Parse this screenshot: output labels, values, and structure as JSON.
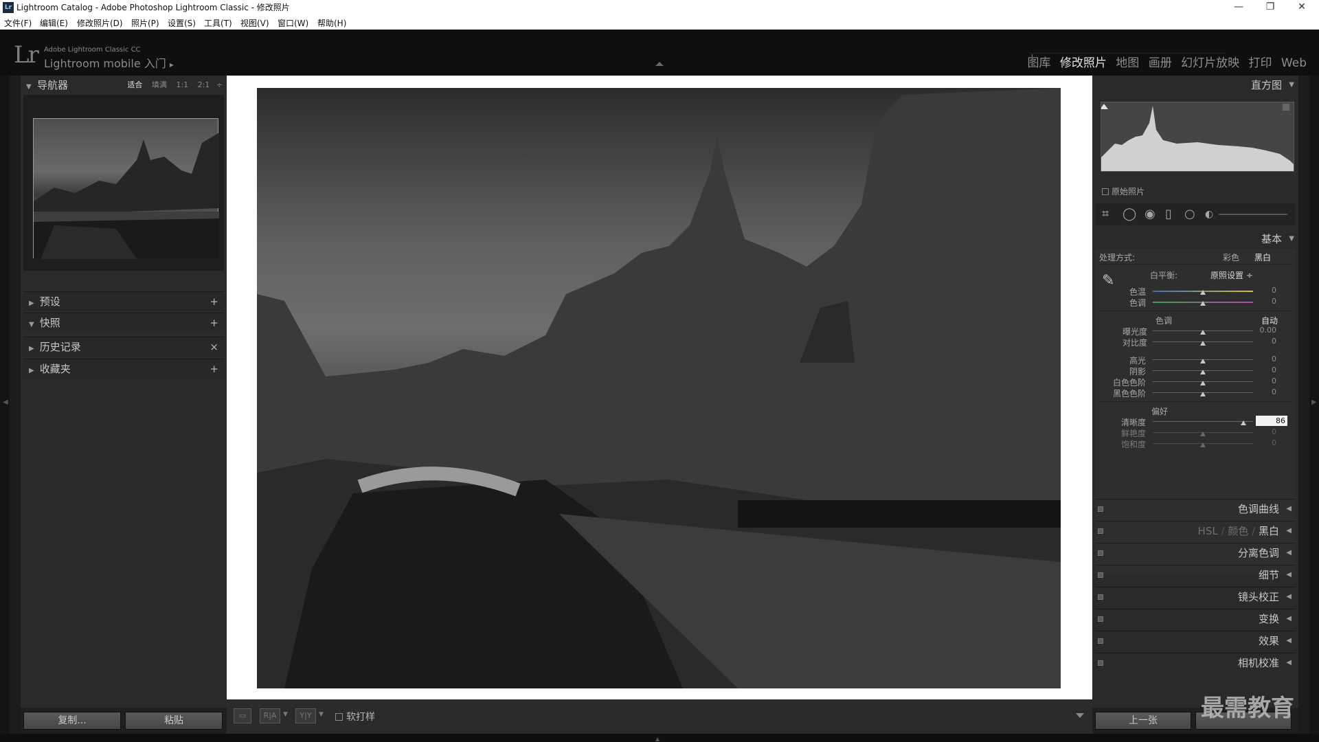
{
  "window": {
    "title": "Lightroom Catalog - Adobe Photoshop Lightroom Classic - 修改照片",
    "app_icon": "Lr",
    "minimize": "—",
    "restore": "❐",
    "close": "✕"
  },
  "menu": [
    "文件(F)",
    "编辑(E)",
    "修改照片(D)",
    "照片(P)",
    "设置(S)",
    "工具(T)",
    "视图(V)",
    "窗口(W)",
    "帮助(H)"
  ],
  "identity": {
    "logo": "Lr",
    "subtitle": "Adobe Lightroom Classic CC",
    "mobile": "Lightroom mobile 入门",
    "play": "▸"
  },
  "modules": {
    "library": "图库",
    "develop": "修改照片",
    "map": "地图",
    "book": "画册",
    "slideshow": "幻灯片放映",
    "print": "打印",
    "web": "Web"
  },
  "left": {
    "navigator": {
      "title": "导航器",
      "fit": "适合",
      "fill": "填满",
      "one": "1:1",
      "two": "2:1"
    },
    "presets": {
      "title": "预设",
      "action": "+"
    },
    "snapshots": {
      "title": "快照",
      "action": "+"
    },
    "history": {
      "title": "历史记录",
      "action": "×"
    },
    "collections": {
      "title": "收藏夹",
      "action": "+"
    },
    "copy_label": "复制...",
    "paste_label": "粘贴"
  },
  "toolbar": {
    "soft_proof": "软打样",
    "ra": "R|A",
    "yy": "Y|Y"
  },
  "right": {
    "histogram": {
      "title": "直方图",
      "original": "原始照片"
    },
    "basic": {
      "title": "基本",
      "treatment": "处理方式:",
      "color": "彩色",
      "bw": "黑白",
      "wb": "白平衡:",
      "wb_value": "原照设置 ÷",
      "temp": {
        "label": "色温",
        "value": "0"
      },
      "tint": {
        "label": "色调",
        "value": "0"
      },
      "tone_title": "色调",
      "auto": "自动",
      "exposure": {
        "label": "曝光度",
        "value": "0.00"
      },
      "contrast": {
        "label": "对比度",
        "value": "0"
      },
      "highlights": {
        "label": "高光",
        "value": "0"
      },
      "shadows": {
        "label": "阴影",
        "value": "0"
      },
      "whites": {
        "label": "白色色阶",
        "value": "0"
      },
      "blacks": {
        "label": "黑色色阶",
        "value": "0"
      },
      "presence_title": "偏好",
      "clarity": {
        "label": "清晰度",
        "value": "86"
      },
      "vibrance": {
        "label": "鲜艳度",
        "value": "0"
      },
      "saturation": {
        "label": "饱和度",
        "value": "0"
      }
    },
    "tone_curve": "色调曲线",
    "hsl": {
      "hsl": "HSL",
      "slash": "/",
      "color": "颜色",
      "bw": "黑白"
    },
    "split_toning": "分离色调",
    "detail": "细节",
    "lens": "镜头校正",
    "transform": "变换",
    "effects": "效果",
    "calibration": "相机校准",
    "prev_label": "上一张"
  },
  "watermark": "最需教育"
}
